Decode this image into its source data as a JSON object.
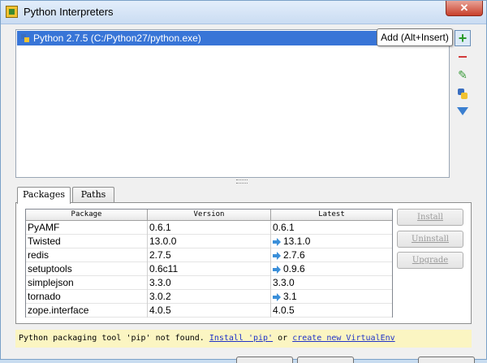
{
  "window": {
    "title": "Python Interpreters",
    "close_symbol": "✕"
  },
  "interpreters": [
    {
      "label": "Python 2.7.5 (C:/Python27/python.exe)",
      "selected": true
    }
  ],
  "toolbar": {
    "add_symbol": "+",
    "edit_symbol": "✎",
    "add_tooltip": "Add (Alt+Insert)"
  },
  "tabs": [
    {
      "label": "Packages",
      "active": true
    },
    {
      "label": "Paths",
      "active": false
    }
  ],
  "table": {
    "headers": [
      "Package",
      "Version",
      "Latest"
    ],
    "rows": [
      {
        "package": "PyAMF",
        "version": "0.6.1",
        "latest": "0.6.1",
        "upgrade": false
      },
      {
        "package": "Twisted",
        "version": "13.0.0",
        "latest": "13.1.0",
        "upgrade": true
      },
      {
        "package": "redis",
        "version": "2.7.5",
        "latest": "2.7.6",
        "upgrade": true
      },
      {
        "package": "setuptools",
        "version": "0.6c11",
        "latest": "0.9.6",
        "upgrade": true
      },
      {
        "package": "simplejson",
        "version": "3.3.0",
        "latest": "3.3.0",
        "upgrade": false
      },
      {
        "package": "tornado",
        "version": "3.0.2",
        "latest": "3.1",
        "upgrade": true
      },
      {
        "package": "zope.interface",
        "version": "4.0.5",
        "latest": "4.0.5",
        "upgrade": false
      }
    ]
  },
  "actions": {
    "install": "Install",
    "uninstall": "Uninstall",
    "upgrade": "Upgrade"
  },
  "warning": {
    "text": "Python packaging tool 'pip' not found.",
    "install_link": "Install 'pip'",
    "or_text": "or",
    "venv_link": "create new VirtualEnv"
  },
  "colors": {
    "selection": "#3875d7",
    "warning_bg": "#fbf5c2",
    "link": "#2033c8",
    "upgrade_arrow": "#3b8fd9"
  }
}
